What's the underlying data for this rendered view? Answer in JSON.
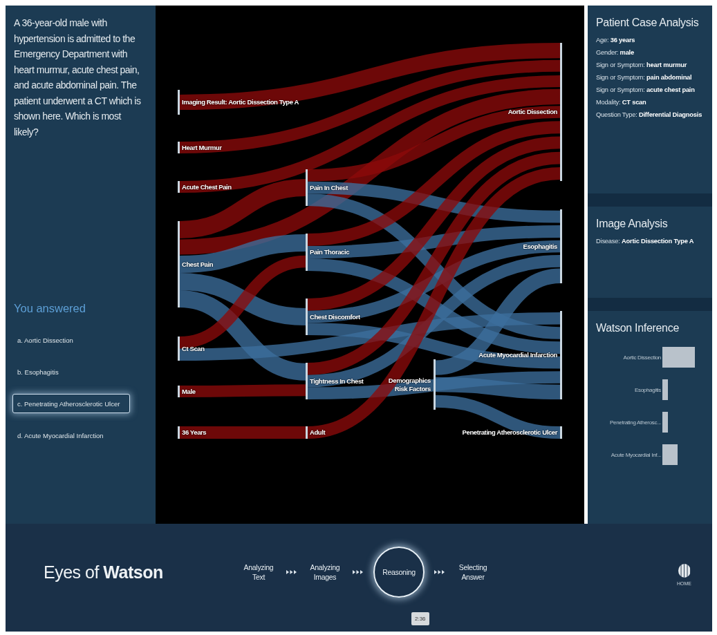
{
  "question": {
    "text": "A 36-year-old male with hypertension is admitted to the Emergency Department with heart murmur, acute chest pain, and acute abdominal pain. The patient underwent a CT which is shown here. Which is most likely?",
    "answered_heading": "You answered",
    "answers": [
      {
        "label": "a. Aortic Dissection",
        "selected": false
      },
      {
        "label": "b. Esophagitis",
        "selected": false
      },
      {
        "label": "c. Penetrating Atherosclerotic Ulcer",
        "selected": true
      },
      {
        "label": "d. Acute Myocardial Infarction",
        "selected": false
      }
    ]
  },
  "sankey": {
    "columns": [
      [
        "Imaging Result: Aortic Dissection Type A",
        "Heart Murmur",
        "Acute Chest Pain",
        "Chest Pain",
        "Ct Scan",
        "Male",
        "36 Years"
      ],
      [
        "Pain In Chest",
        "Pain Thoracic",
        "Chest Discomfort",
        "Tightness In Chest",
        "Adult"
      ],
      [
        "Demographics Risk Factors"
      ],
      [
        "Aortic Dissection",
        "Esophagitis",
        "Acute Myocardial Infarction",
        "Penetrating Atherosclerotic Ulcer"
      ]
    ]
  },
  "patient_case": {
    "title": "Patient Case Analysis",
    "facts": [
      "Age: **36 years**",
      "Gender: **male**",
      "Sign or Symptom: **heart murmur**",
      "Sign or Symptom: **pain abdominal**",
      "Sign or Symptom: **acute chest pain**",
      "Modality: **CT scan**",
      "Question Type: **Differential Diagnosis**"
    ]
  },
  "image_analysis": {
    "title": "Image Analysis",
    "facts": [
      "Disease: **Aortic Dissection Type A**"
    ]
  },
  "watson_inference": {
    "title": "Watson Inference",
    "bars": [
      "Aortic Dissection",
      "Esophagitis",
      "Penetrating Atherosc...",
      "Acute Myocardial Inf..."
    ]
  },
  "footer": {
    "title": "Eyes of **Watson**",
    "steps": [
      {
        "label": "Analyzing Text",
        "selected": false
      },
      {
        "label": "Analyzing Images",
        "selected": false
      },
      {
        "label": "Reasoning",
        "selected": true
      },
      {
        "label": "Selecting Answer",
        "selected": false
      }
    ],
    "home_label": "HOME",
    "timer": "2:36"
  }
}
